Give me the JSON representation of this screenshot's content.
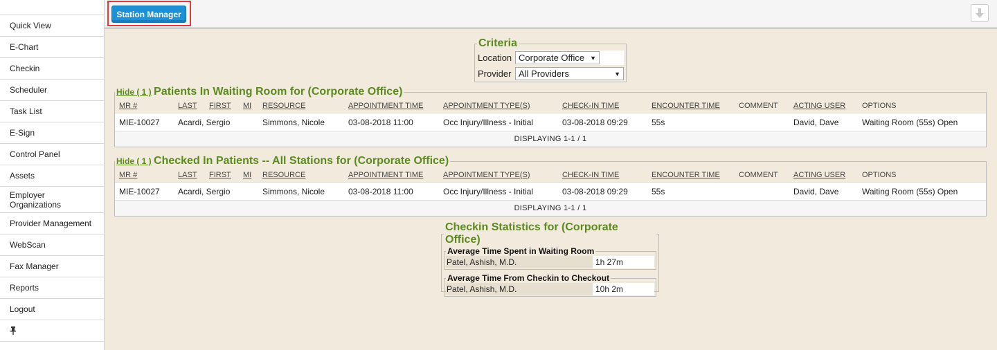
{
  "sidebar": {
    "items": [
      {
        "label": "Quick View"
      },
      {
        "label": "E-Chart"
      },
      {
        "label": "Checkin"
      },
      {
        "label": "Scheduler"
      },
      {
        "label": "Task List"
      },
      {
        "label": "E-Sign"
      },
      {
        "label": "Control Panel"
      },
      {
        "label": "Assets"
      },
      {
        "label": "Employer Organizations"
      },
      {
        "label": "Provider Management"
      },
      {
        "label": "WebScan"
      },
      {
        "label": "Fax Manager"
      },
      {
        "label": "Reports"
      },
      {
        "label": "Logout"
      }
    ],
    "pin_icon": "pin-icon"
  },
  "topbar": {
    "tab_label": "Station Manager",
    "download_icon": "download-arrow-icon"
  },
  "criteria": {
    "title": "Criteria",
    "location_label": "Location",
    "location_value": "Corporate Office",
    "provider_label": "Provider",
    "provider_value": "All Providers"
  },
  "columns": [
    "MR #",
    "LAST",
    "FIRST",
    "MI",
    "RESOURCE",
    "APPOINTMENT TIME",
    "APPOINTMENT TYPE(S)",
    "CHECK-IN TIME",
    "ENCOUNTER TIME",
    "COMMENT",
    "ACTING USER",
    "OPTIONS"
  ],
  "waiting": {
    "hide_label": "Hide ( 1 )",
    "title": "Patients In Waiting Room for (Corporate Office)",
    "rows": [
      {
        "mr": "MIE-10027",
        "name": "Acardi, Sergio",
        "resource": "Simmons, Nicole",
        "appt_time": "03-08-2018 11:00",
        "appt_type": "Occ Injury/Illness - Initial",
        "checkin_time": "03-08-2018 09:29",
        "encounter_time": "55s",
        "comment": "",
        "acting_user": "David, Dave",
        "options": "Waiting Room (55s) Open"
      }
    ],
    "footer": "DISPLAYING 1-1 / 1"
  },
  "checked_in": {
    "hide_label": "Hide ( 1 )",
    "title": "Checked In Patients -- All Stations for (Corporate Office)",
    "rows": [
      {
        "mr": "MIE-10027",
        "name": "Acardi, Sergio",
        "resource": "Simmons, Nicole",
        "appt_time": "03-08-2018 11:00",
        "appt_type": "Occ Injury/Illness - Initial",
        "checkin_time": "03-08-2018 09:29",
        "encounter_time": "55s",
        "comment": "",
        "acting_user": "David, Dave",
        "options": "Waiting Room (55s) Open"
      }
    ],
    "footer": "DISPLAYING 1-1 / 1"
  },
  "stats": {
    "title": "Checkin Statistics for (Corporate Office)",
    "waiting": {
      "title": "Average Time Spent in Waiting Room",
      "provider": "Patel, Ashish, M.D.",
      "value": "1h 27m"
    },
    "checkout": {
      "title": "Average Time From Checkin to Checkout",
      "provider": "Patel, Ashish, M.D.",
      "value": "10h 2m"
    }
  }
}
